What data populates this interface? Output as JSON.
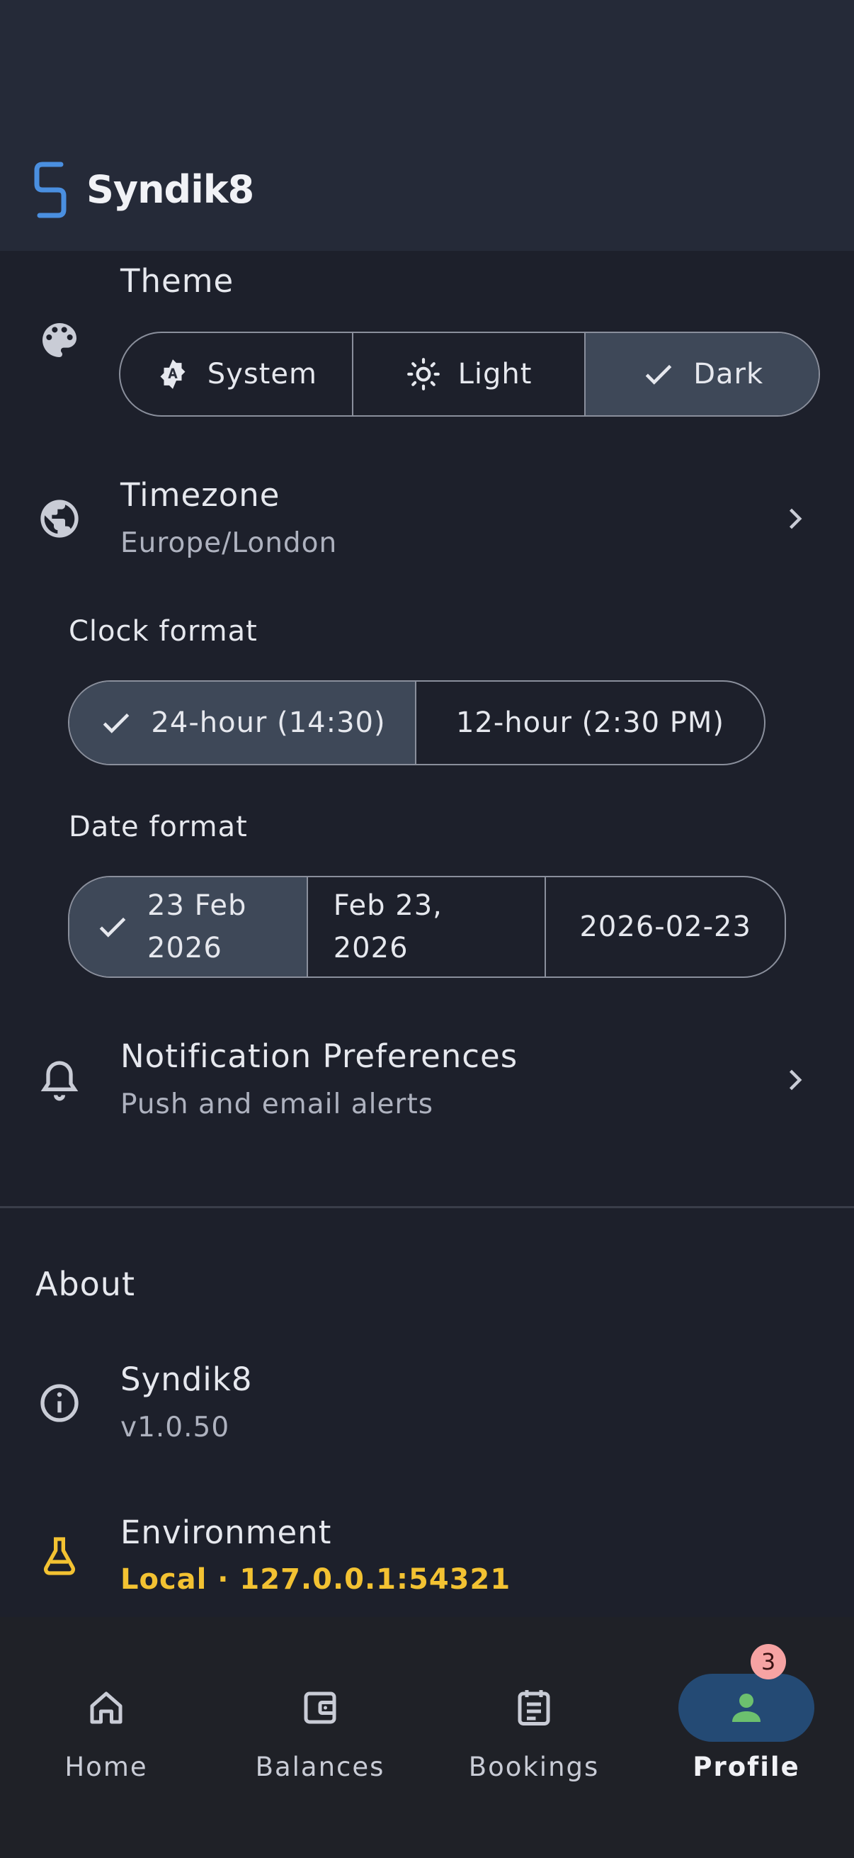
{
  "app": {
    "name": "Syndik8"
  },
  "theme": {
    "title": "Theme",
    "options": [
      {
        "label": "System",
        "icon": "brightness-auto-icon",
        "selected": false
      },
      {
        "label": "Light",
        "icon": "sun-icon",
        "selected": false
      },
      {
        "label": "Dark",
        "icon": "check-icon",
        "selected": true
      }
    ]
  },
  "timezone": {
    "title": "Timezone",
    "value": "Europe/London"
  },
  "clock_format": {
    "label": "Clock format",
    "options": [
      {
        "label": "24-hour (14:30)",
        "selected": true
      },
      {
        "label": "12-hour (2:30 PM)",
        "selected": false
      }
    ]
  },
  "date_format": {
    "label": "Date format",
    "options": [
      {
        "label": "23 Feb 2026",
        "selected": true
      },
      {
        "label": "Feb 23, 2026",
        "selected": false
      },
      {
        "label": "2026-02-23",
        "selected": false
      }
    ]
  },
  "notifications": {
    "title": "Notification Preferences",
    "subtitle": "Push and email alerts"
  },
  "about": {
    "heading": "About",
    "app_name": "Syndik8",
    "version": "v1.0.50",
    "environment_title": "Environment",
    "environment_value": "Local · 127.0.0.1:54321"
  },
  "bottom_nav": {
    "items": [
      {
        "label": "Home",
        "icon": "home-icon",
        "active": false
      },
      {
        "label": "Balances",
        "icon": "wallet-icon",
        "active": false
      },
      {
        "label": "Bookings",
        "icon": "clipboard-list-icon",
        "active": false
      },
      {
        "label": "Profile",
        "icon": "person-icon",
        "active": true,
        "badge": "3"
      }
    ]
  },
  "colors": {
    "background": "#1d202b",
    "appbar": "#252a38",
    "selected_segment": "#3e4858",
    "accent_blue": "#4a8fe0",
    "environment_yellow": "#f3c232",
    "nav_active_pill": "#244a74",
    "badge": "#f6a3a3"
  }
}
